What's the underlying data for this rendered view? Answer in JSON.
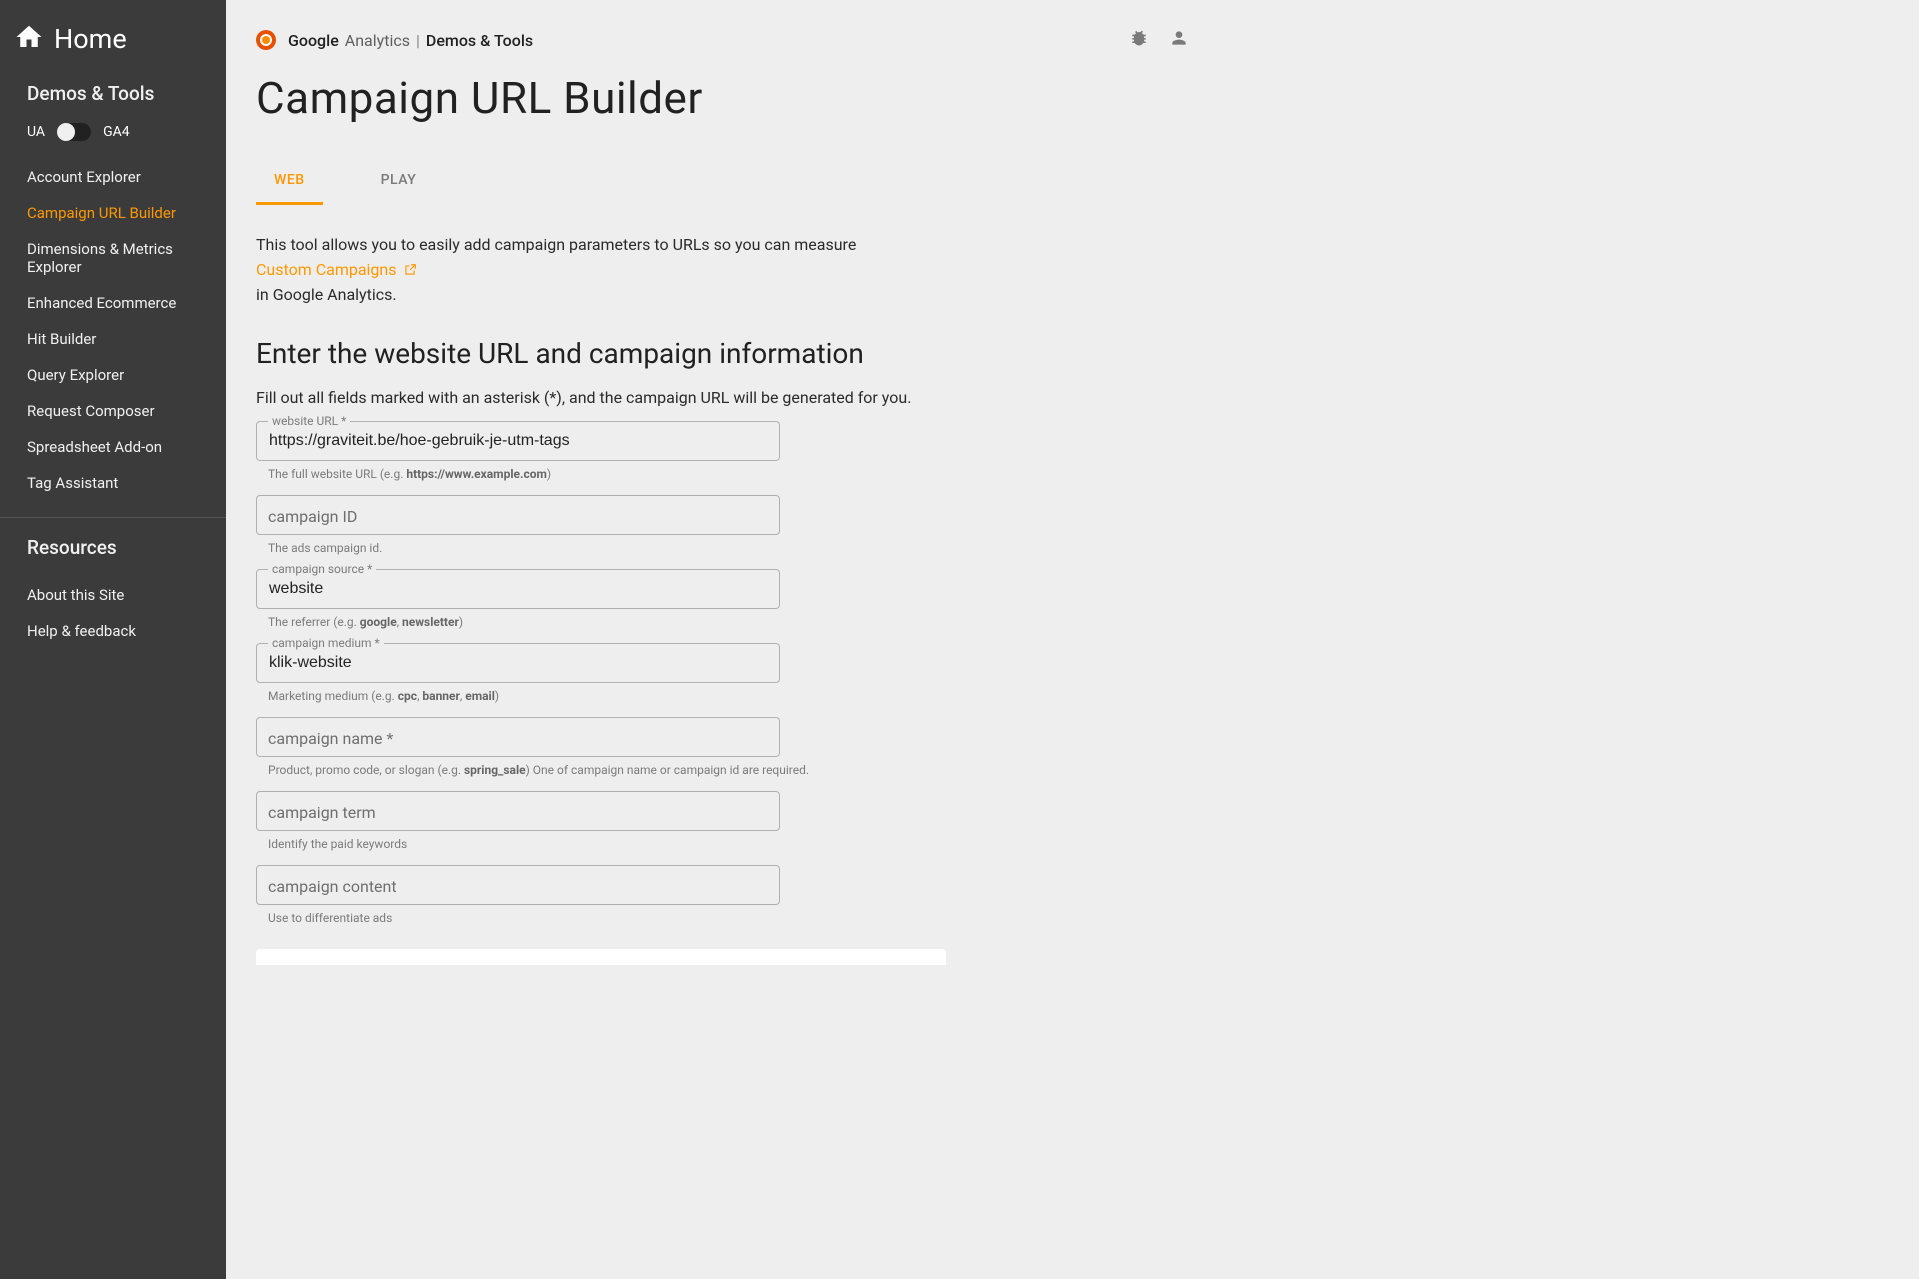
{
  "sidebar": {
    "home_label": "Home",
    "section1_title": "Demos & Tools",
    "toggle": {
      "left": "UA",
      "right": "GA4"
    },
    "nav_items": [
      {
        "label": "Account Explorer",
        "active": false
      },
      {
        "label": "Campaign URL Builder",
        "active": true
      },
      {
        "label": "Dimensions & Metrics Explorer",
        "active": false
      },
      {
        "label": "Enhanced Ecommerce",
        "active": false
      },
      {
        "label": "Hit Builder",
        "active": false
      },
      {
        "label": "Query Explorer",
        "active": false
      },
      {
        "label": "Request Composer",
        "active": false
      },
      {
        "label": "Spreadsheet Add-on",
        "active": false
      },
      {
        "label": "Tag Assistant",
        "active": false
      }
    ],
    "section2_title": "Resources",
    "resource_items": [
      {
        "label": "About this Site"
      },
      {
        "label": "Help & feedback"
      }
    ]
  },
  "header": {
    "brand_google": "Google",
    "brand_analytics": "Analytics",
    "brand_sep": "|",
    "brand_demos": "Demos & Tools"
  },
  "page": {
    "title": "Campaign URL Builder",
    "tabs": {
      "web": "WEB",
      "play": "PLAY"
    },
    "intro_line1": "This tool allows you to easily add campaign parameters to URLs so you can measure",
    "intro_link": "Custom Campaigns",
    "intro_line2": "in Google Analytics.",
    "subheading": "Enter the website URL and campaign information",
    "form_help": "Fill out all fields marked with an asterisk (*), and the campaign URL will be generated for you."
  },
  "form": {
    "website_url": {
      "label": "website URL *",
      "value": "https://graviteit.be/hoe-gebruik-je-utm-tags",
      "hint_pre": "The full website URL (e.g. ",
      "hint_strong": "https://www.example.com",
      "hint_post": ")"
    },
    "campaign_id": {
      "placeholder": "campaign ID",
      "value": "",
      "hint": "The ads campaign id."
    },
    "campaign_source": {
      "label": "campaign source *",
      "value": "website",
      "hint_pre": "The referrer (e.g. ",
      "hint_strong1": "google",
      "hint_sep": ", ",
      "hint_strong2": "newsletter",
      "hint_post": ")"
    },
    "campaign_medium": {
      "label": "campaign medium *",
      "value": "klik-website",
      "hint_pre": "Marketing medium (e.g. ",
      "hint_strong1": "cpc",
      "hint_sep1": ", ",
      "hint_strong2": "banner",
      "hint_sep2": ", ",
      "hint_strong3": "email",
      "hint_post": ")"
    },
    "campaign_name": {
      "placeholder": "campaign name *",
      "value": "",
      "hint_pre": "Product, promo code, or slogan (e.g. ",
      "hint_strong": "spring_sale",
      "hint_post": ") One of campaign name or campaign id are required."
    },
    "campaign_term": {
      "placeholder": "campaign term",
      "value": "",
      "hint": "Identify the paid keywords"
    },
    "campaign_content": {
      "placeholder": "campaign content",
      "value": "",
      "hint": "Use to differentiate ads"
    }
  }
}
